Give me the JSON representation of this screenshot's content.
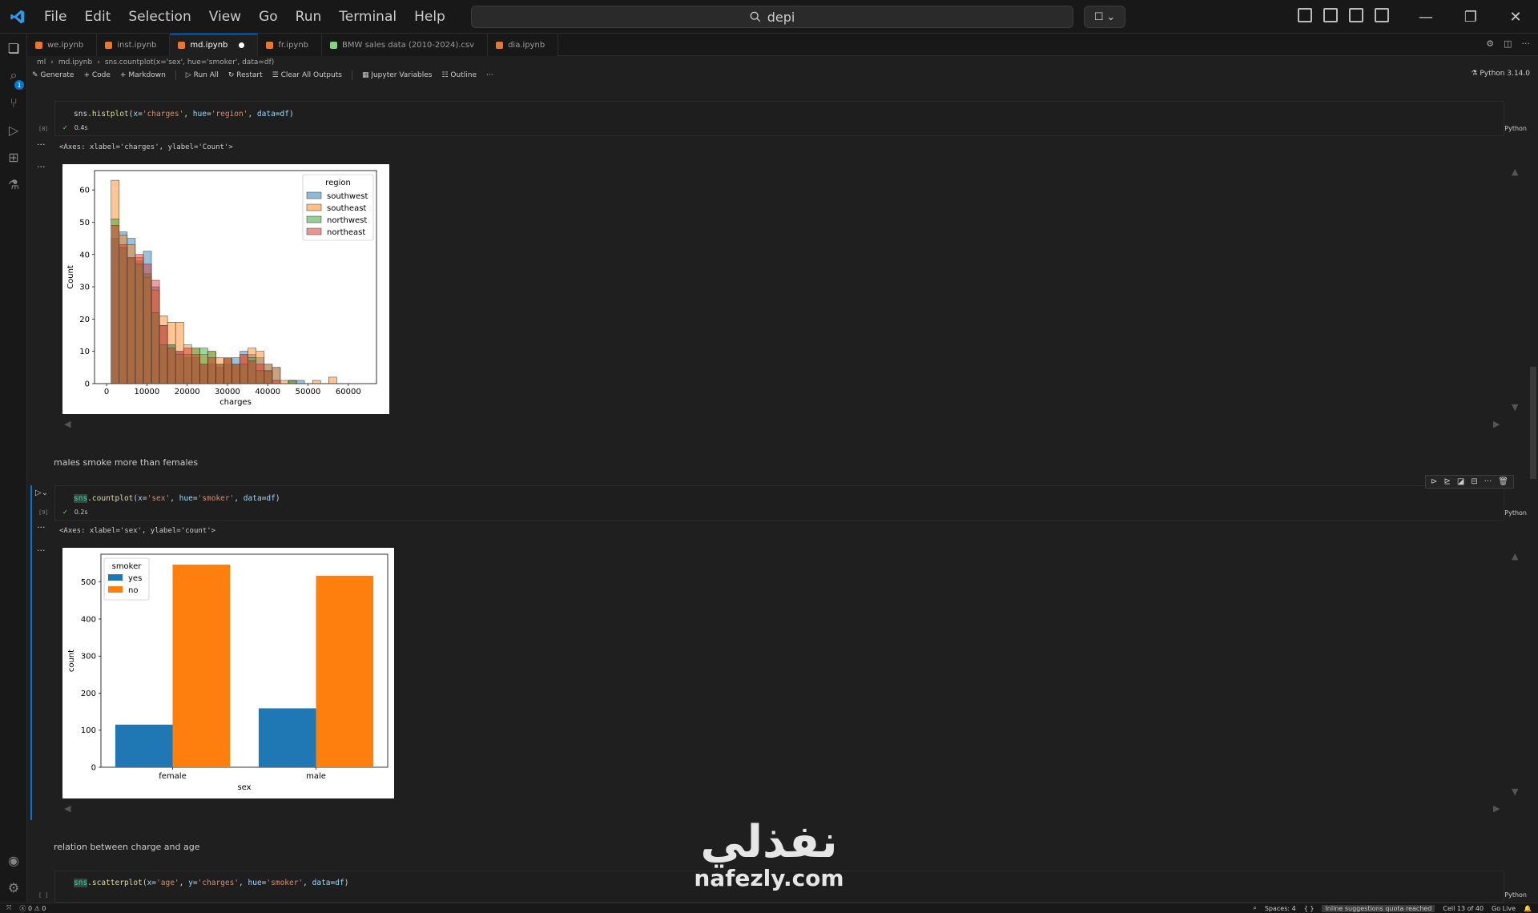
{
  "menu": [
    "File",
    "Edit",
    "Selection",
    "View",
    "Go",
    "Run",
    "Terminal",
    "Help"
  ],
  "search": {
    "text": "depi"
  },
  "tabs": [
    {
      "label": "we.ipynb",
      "type": "nb"
    },
    {
      "label": "inst.ipynb",
      "type": "nb"
    },
    {
      "label": "md.ipynb",
      "type": "nb",
      "active": true
    },
    {
      "label": "fr.ipynb",
      "type": "nb"
    },
    {
      "label": "BMW sales data (2010-2024).csv",
      "type": "csv"
    },
    {
      "label": "dia.ipynb",
      "type": "nb"
    }
  ],
  "breadcrumb": [
    "ml",
    "md.ipynb",
    "sns.countplot(x='sex', hue='smoker', data=df)"
  ],
  "toolbar": {
    "generate": "Generate",
    "code": "Code",
    "markdown": "Markdown",
    "run_all": "Run All",
    "restart": "Restart",
    "clear": "Clear All Outputs",
    "variables": "Jupyter Variables",
    "outline": "Outline",
    "more": "···"
  },
  "kernel": "Python 3.14.0",
  "cells": {
    "c1": {
      "count": "[8]",
      "time": "0.4s",
      "lang": "Python",
      "output": "<Axes: xlabel='charges', ylabel='Count'>"
    },
    "md1": {
      "text": "males smoke more than females"
    },
    "c2": {
      "count": "[9]",
      "time": "0.2s",
      "lang": "Python",
      "output": "<Axes: xlabel='sex', ylabel='count'>"
    },
    "md2": {
      "text": "relation between charge and age"
    },
    "c3": {
      "count": "[ ]",
      "lang": "Python"
    }
  },
  "colors": {
    "southwest": "#1f77b4",
    "southeast": "#ff7f0e",
    "northwest": "#2ca02c",
    "northeast": "#d62728",
    "yes": "#1f77b4",
    "no": "#ff7f0e"
  },
  "chart_data": [
    {
      "type": "bar",
      "subtype": "histogram",
      "xlabel": "charges",
      "ylabel": "Count",
      "xticks": [
        "0",
        "10000",
        "20000",
        "30000",
        "40000",
        "50000",
        "60000"
      ],
      "yticks": [
        "0",
        "10",
        "20",
        "30",
        "40",
        "50",
        "60"
      ],
      "xlim": [
        -3000,
        67000
      ],
      "ylim": [
        0,
        66
      ],
      "bin_start": 1122,
      "bin_width": 2000,
      "legend": {
        "title": "region",
        "placement": "top-right",
        "entries": [
          "southwest",
          "southeast",
          "northwest",
          "northeast"
        ]
      },
      "series": [
        {
          "name": "southwest",
          "values": [
            45,
            47,
            45,
            38,
            41,
            30,
            18,
            12,
            10,
            8,
            8,
            6,
            6,
            5,
            6,
            8,
            10,
            9,
            8,
            6,
            5,
            0,
            1,
            1,
            0,
            0,
            0,
            0,
            0,
            0
          ]
        },
        {
          "name": "southeast",
          "values": [
            63,
            46,
            43,
            39,
            33,
            29,
            21,
            19,
            19,
            12,
            11,
            9,
            10,
            8,
            8,
            6,
            9,
            11,
            10,
            6,
            5,
            1,
            1,
            0,
            0,
            1,
            0,
            2,
            0,
            0
          ]
        },
        {
          "name": "northwest",
          "values": [
            51,
            42,
            39,
            37,
            34,
            22,
            12,
            12,
            9,
            9,
            11,
            11,
            10,
            6,
            8,
            6,
            6,
            8,
            4,
            4,
            0,
            0,
            1,
            0,
            0,
            0,
            0,
            0,
            0,
            0
          ]
        },
        {
          "name": "northeast",
          "values": [
            49,
            43,
            39,
            40,
            37,
            32,
            18,
            11,
            10,
            11,
            9,
            6,
            8,
            6,
            8,
            6,
            9,
            7,
            6,
            4,
            1,
            0,
            0,
            0,
            0,
            0,
            0,
            0,
            0,
            0
          ]
        }
      ]
    },
    {
      "type": "bar",
      "xlabel": "sex",
      "ylabel": "count",
      "categories": [
        "female",
        "male"
      ],
      "yticks": [
        "0",
        "100",
        "200",
        "300",
        "400",
        "500"
      ],
      "ylim": [
        0,
        575
      ],
      "legend": {
        "title": "smoker",
        "placement": "top-left",
        "entries": [
          "yes",
          "no"
        ]
      },
      "series": [
        {
          "name": "yes",
          "values": [
            115,
            159
          ]
        },
        {
          "name": "no",
          "values": [
            547,
            517
          ]
        }
      ]
    }
  ]
}
